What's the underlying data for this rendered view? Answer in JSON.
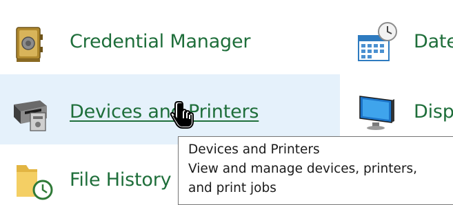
{
  "control_panel": {
    "items_left": [
      {
        "label": "Credential Manager",
        "icon": "credential-manager-safe-icon"
      },
      {
        "label": "Devices and Printers",
        "icon": "devices-printers-icon",
        "hovered": true
      },
      {
        "label": "File History",
        "icon": "file-history-folder-icon"
      }
    ],
    "items_right": [
      {
        "label": "Date",
        "icon": "date-time-calendar-clock-icon"
      },
      {
        "label": "Disp",
        "icon": "display-monitor-icon"
      }
    ]
  },
  "tooltip": {
    "title": "Devices and Printers",
    "line1": "View and manage devices, printers,",
    "line2": "and print jobs"
  },
  "colors": {
    "link": "#1e6e3a",
    "hover_background": "#e5f1fb",
    "tooltip_border": "#767676"
  }
}
